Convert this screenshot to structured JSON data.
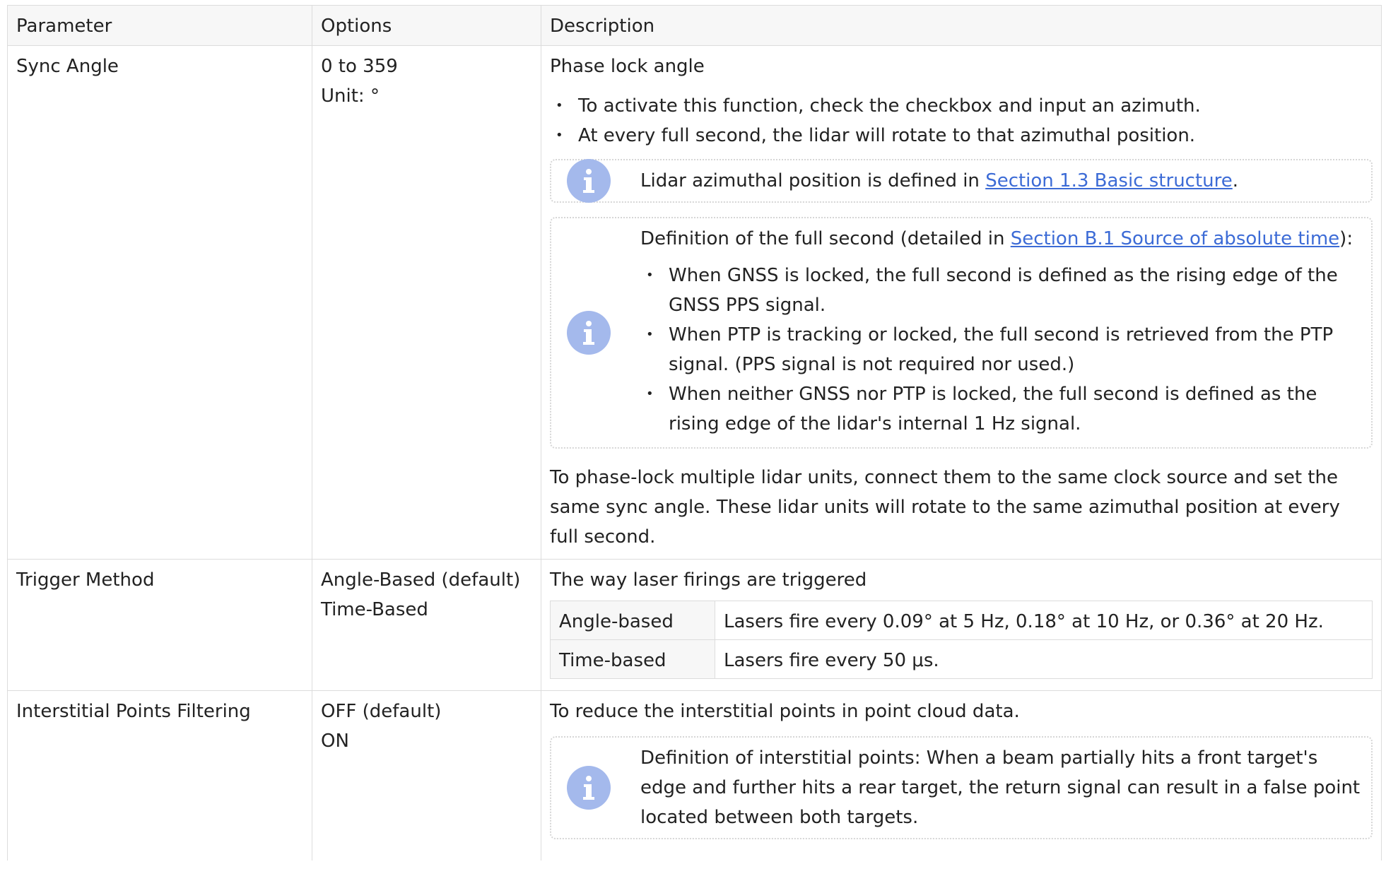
{
  "headers": {
    "parameter": "Parameter",
    "options": "Options",
    "description": "Description"
  },
  "sync_angle": {
    "parameter": "Sync Angle",
    "options": [
      "0 to 359",
      "Unit: °"
    ],
    "title": "Phase lock angle",
    "bullets": [
      "To activate this function, check the checkbox and input an azimuth.",
      "At every full second, the lidar will rotate to that azimuthal position."
    ],
    "note1": {
      "text_before": "Lidar azimuthal position is defined in ",
      "link": "Section 1.3 Basic structure",
      "text_after": "."
    },
    "note2": {
      "text_before": "Definition of the full second (detailed in ",
      "link": "Section B.1 Source of absolute time",
      "text_after": "):",
      "bullets": [
        "When GNSS is locked, the full second is defined as the rising edge of the GNSS PPS signal.",
        "When PTP is tracking or locked, the full second is retrieved from the PTP signal. (PPS signal is not required nor used.)",
        "When neither GNSS nor PTP is locked, the full second is defined as the rising edge of the lidar's internal 1 Hz signal."
      ]
    },
    "footer": "To phase-lock multiple lidar units, connect them to the same clock source and set the same sync angle. These lidar units will rotate to the same azimuthal position at every full second."
  },
  "trigger_method": {
    "parameter": "Trigger Method",
    "options": [
      "Angle-Based (default)",
      "Time-Based"
    ],
    "title": "The way laser firings are triggered",
    "rows": [
      {
        "key": "Angle-based",
        "value": "Lasers fire every 0.09° at 5 Hz, 0.18° at 10 Hz, or 0.36° at 20 Hz."
      },
      {
        "key": "Time-based",
        "value": "Lasers fire every 50 μs."
      }
    ]
  },
  "interstitial": {
    "parameter": "Interstitial Points Filtering",
    "options": [
      "OFF (default)",
      "ON"
    ],
    "title": "To reduce the interstitial points in point cloud data.",
    "note": "Definition of interstitial points: When a beam partially hits a front target's edge and further hits a rear target, the return signal can result in a false point located between both targets."
  },
  "icons": {
    "note": "info-icon"
  },
  "colors": {
    "link": "#3c6bd6",
    "info_icon": "#a4b9ec",
    "header_bg": "#f7f7f7",
    "border": "#dcdcdc"
  }
}
